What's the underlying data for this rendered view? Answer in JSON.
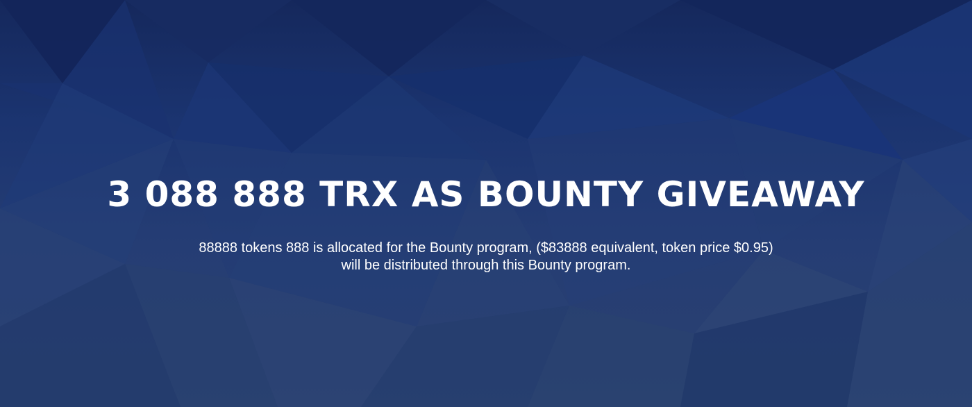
{
  "banner": {
    "headline": "3 088 888 TRX AS BOUNTY GIVEAWAY",
    "description_line_1": "88888 tokens 888 is allocated for the Bounty program, ($83888 equivalent, token price $0.95)",
    "description_line_2": "will be distributed through this Bounty program."
  },
  "colors": {
    "background_top": "#15285c",
    "background_bottom": "#2b4170",
    "text": "#ffffff"
  }
}
